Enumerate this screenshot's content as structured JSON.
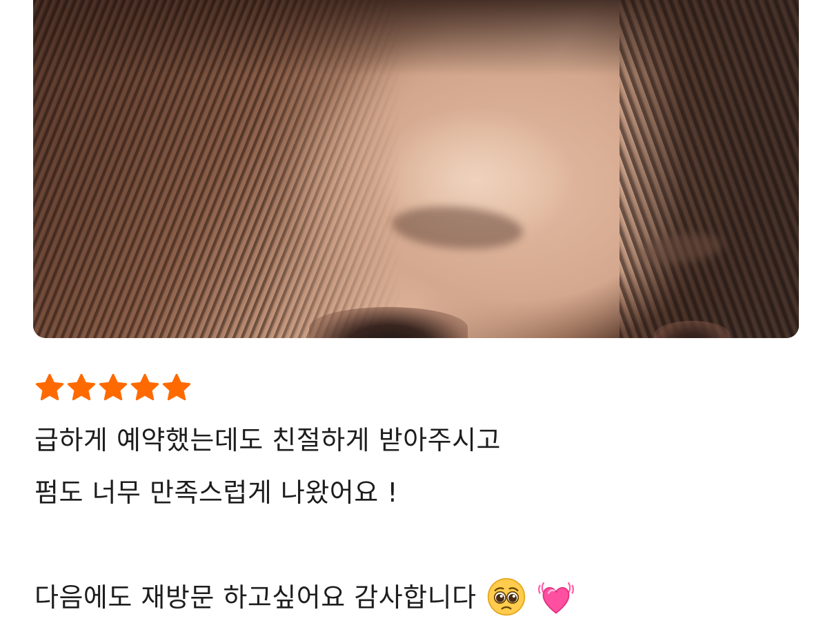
{
  "review": {
    "rating": 5,
    "rating_max": 5,
    "star_color": "#ff6a00",
    "lines": [
      "급하게 예약했는데도 친절하게 받아주시고",
      "펌도 너무 만족스럽게 나왔어요 !",
      "",
      "다음에도 재방문 하고싶어요 감사합니다"
    ],
    "emojis": [
      "pleading-face-emoji",
      "growing-heart-emoji"
    ]
  }
}
